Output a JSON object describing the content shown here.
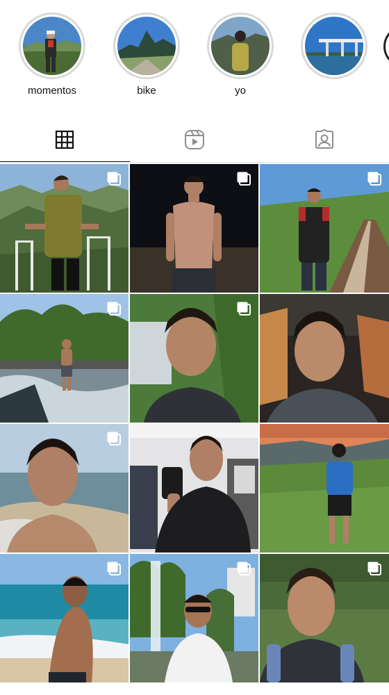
{
  "highlights": [
    {
      "label": "momentos",
      "icon": "highlight-momentos"
    },
    {
      "label": "bike",
      "icon": "highlight-bike"
    },
    {
      "label": "yo",
      "icon": "highlight-yo"
    },
    {
      "label": "",
      "icon": "highlight-bridge"
    }
  ],
  "tabs": [
    {
      "name": "posts-grid",
      "icon": "grid-icon",
      "active": true
    },
    {
      "name": "reels",
      "icon": "reels-icon",
      "active": false
    },
    {
      "name": "tagged",
      "icon": "tagged-person-icon",
      "active": false
    }
  ],
  "grid": {
    "posts": [
      {
        "scene": "mountain-railing-olive-tshirt",
        "multiple": true
      },
      {
        "scene": "night-shirtless",
        "multiple": true
      },
      {
        "scene": "railway-bridge-green-hills",
        "multiple": true
      },
      {
        "scene": "river-rocks-waterfall",
        "multiple": true
      },
      {
        "scene": "selfie-waterfall-trees",
        "multiple": true
      },
      {
        "scene": "selfie-car",
        "multiple": false
      },
      {
        "scene": "beach-selfie",
        "multiple": true
      },
      {
        "scene": "mirror-selfie-store",
        "multiple": false
      },
      {
        "scene": "sunset-hill-blue-shirt",
        "multiple": false
      },
      {
        "scene": "beach-back-view",
        "multiple": true
      },
      {
        "scene": "fountain-sunglasses",
        "multiple": true
      },
      {
        "scene": "backpack-selfie-trees",
        "multiple": true
      }
    ]
  },
  "colors": {
    "text": "#111111",
    "ring": "#d9d9d9",
    "divider": "#e2e2e2"
  }
}
